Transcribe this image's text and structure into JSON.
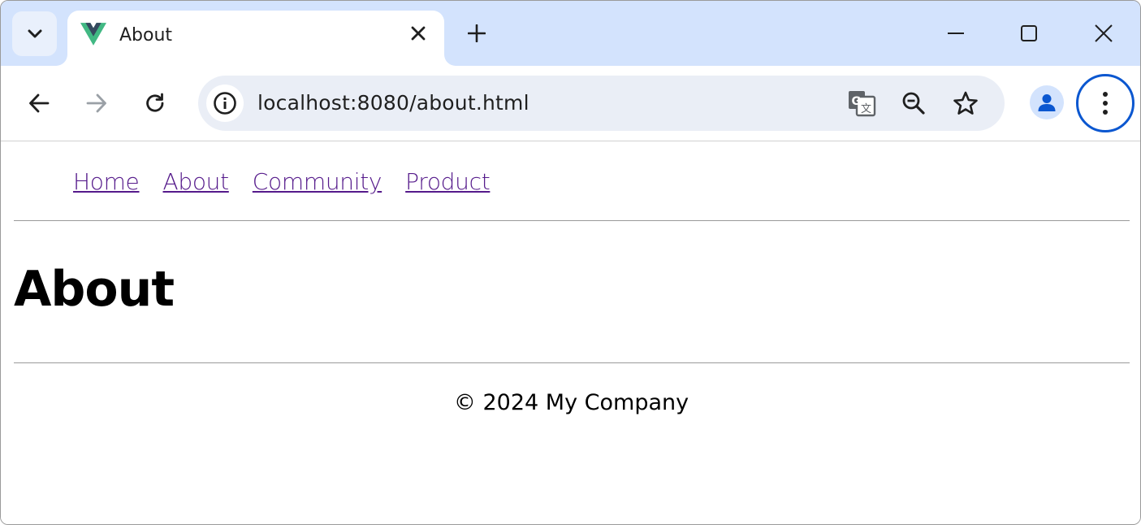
{
  "browser": {
    "tab": {
      "title": "About"
    },
    "omnibox": {
      "url": "localhost:8080/about.html"
    }
  },
  "page": {
    "nav": [
      {
        "label": "Home"
      },
      {
        "label": "About"
      },
      {
        "label": "Community"
      },
      {
        "label": "Product"
      }
    ],
    "heading": "About",
    "footer": "© 2024 My Company"
  },
  "colors": {
    "tabstrip": "#d3e3fd",
    "omnibox": "#eaeef6",
    "link_visited": "#551a8b",
    "menu_focus_ring": "#0b57d0",
    "profile_icon": "#0b57d0",
    "vue_green": "#41b883",
    "vue_dark": "#35495e"
  }
}
